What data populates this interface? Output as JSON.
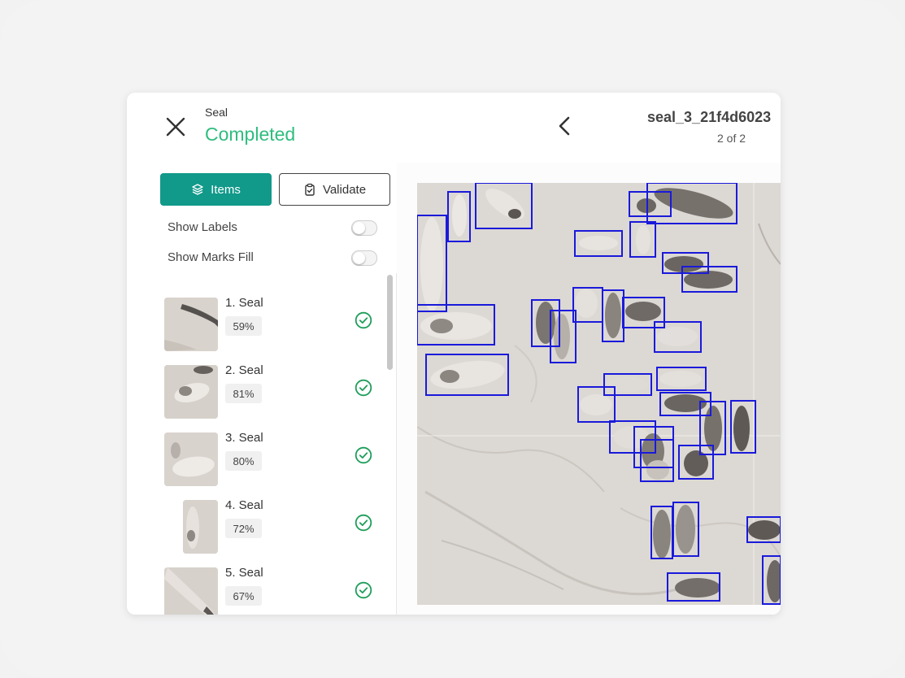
{
  "header": {
    "project_name": "Seal",
    "status": "Completed",
    "file_name": "seal_3_21f4d6023",
    "page_indicator": "2 of 2"
  },
  "sidebar": {
    "tabs": {
      "items_label": "Items",
      "validate_label": "Validate"
    },
    "toggles": {
      "show_labels": "Show Labels",
      "show_marks_fill": "Show Marks Fill"
    },
    "items": [
      {
        "label": "1. Seal",
        "confidence": "59%"
      },
      {
        "label": "2. Seal",
        "confidence": "81%"
      },
      {
        "label": "3. Seal",
        "confidence": "80%"
      },
      {
        "label": "4. Seal",
        "confidence": "72%"
      },
      {
        "label": "5. Seal",
        "confidence": "67%"
      }
    ]
  },
  "colors": {
    "accent": "#11998a",
    "status_green": "#2fbd7e",
    "check_green": "#1e9e5a",
    "box_blue": "#1a1adb"
  },
  "icons": [
    "close-icon",
    "chevron-left-icon",
    "layers-icon",
    "clipboard-check-icon",
    "check-circle-icon"
  ]
}
